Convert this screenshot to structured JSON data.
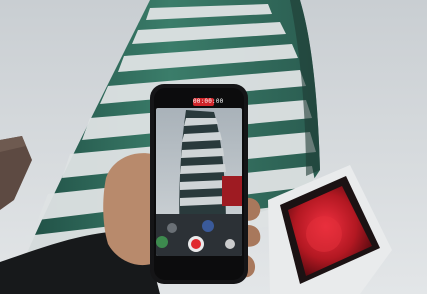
{
  "photo": {
    "subject": "phone-recording-tower",
    "sky_color": "#d6dadd",
    "tower_glass_color": "#2f6a5a",
    "tower_slab_color": "#dfe3e4",
    "billboard_color": "#b31822",
    "phone_frame_color": "#151517"
  },
  "phone_screen": {
    "recording_timer": "00:00:00",
    "record_color": "#e02a2f"
  }
}
